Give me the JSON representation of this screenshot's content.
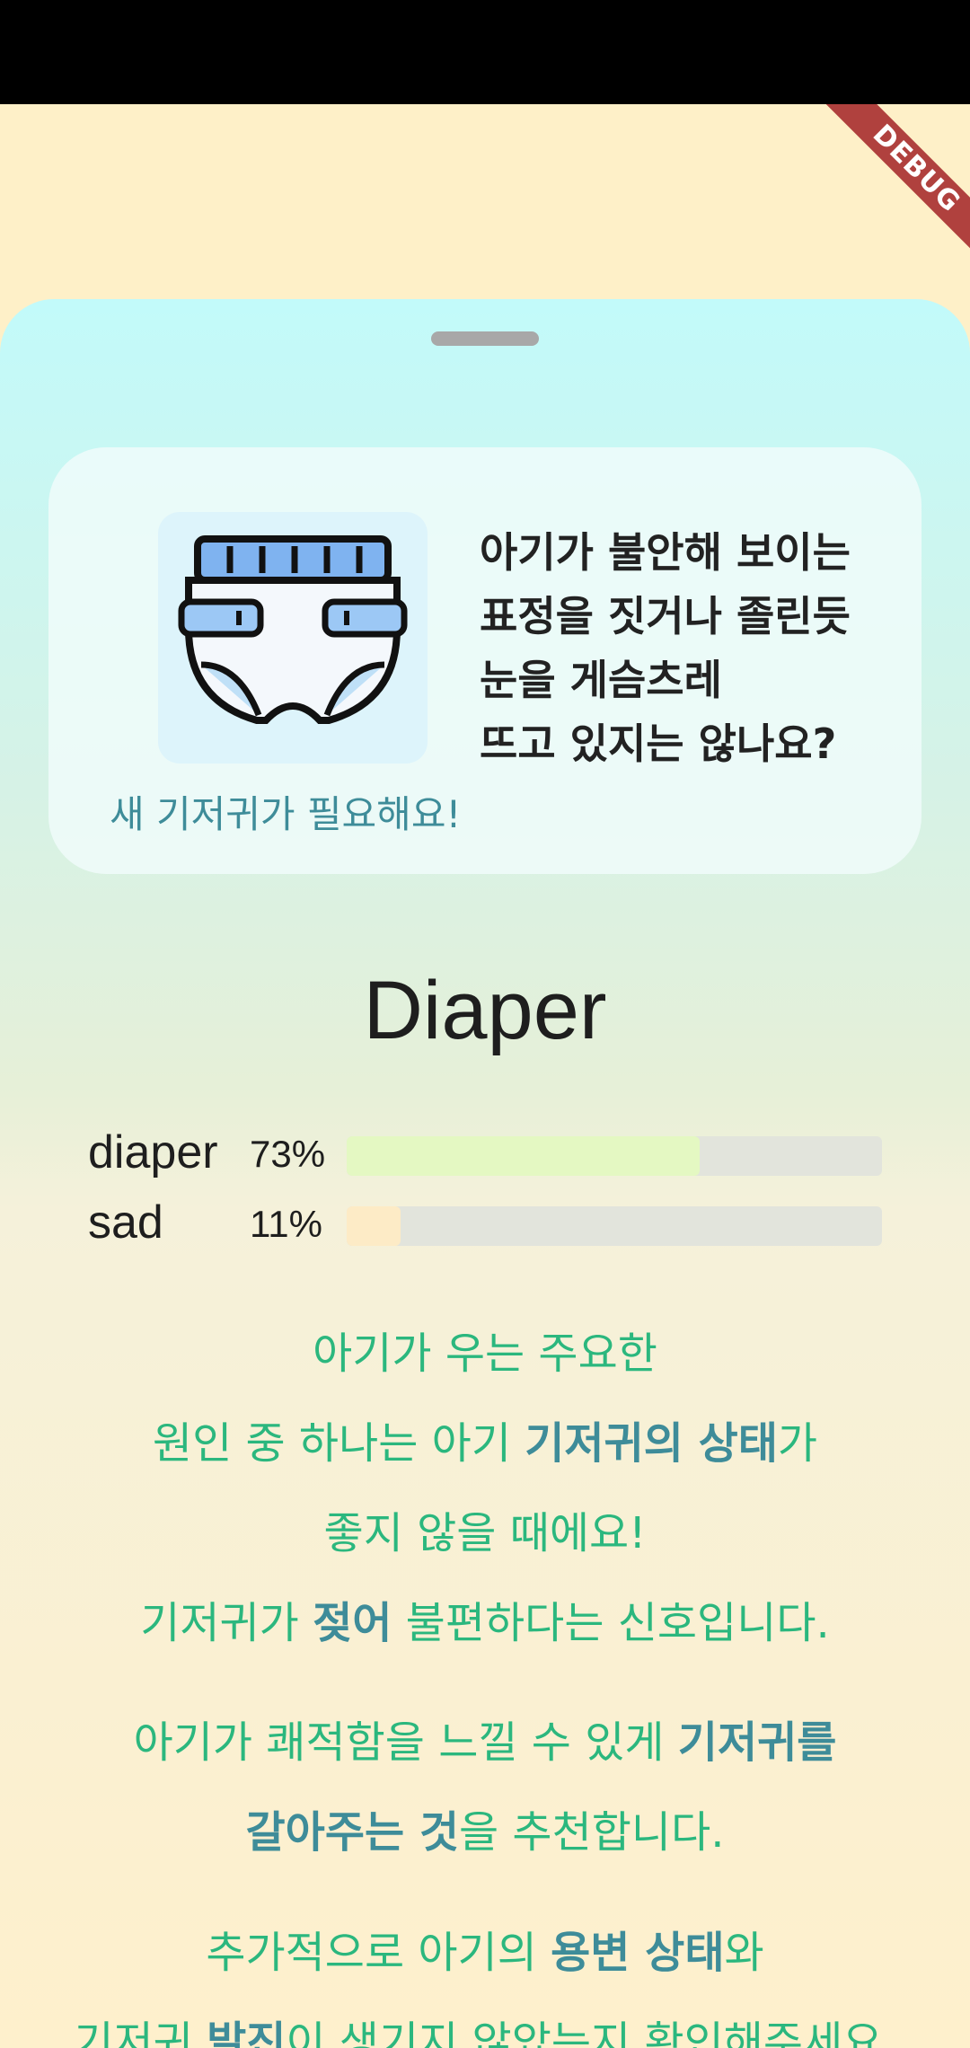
{
  "debug_banner": "DEBUG",
  "card": {
    "question_lines": [
      "아기가 불안해 보이는",
      "표정을 짓거나 졸린듯",
      "눈을 게슴츠레",
      "뜨고 있지는 않나요?"
    ],
    "subtitle": "새 기저귀가 필요해요!",
    "icon": "diaper-icon"
  },
  "class_title": "Diaper",
  "probabilities": [
    {
      "label": "diaper",
      "percent_text": "73%",
      "value": 0.66,
      "color": "#E4F8C2"
    },
    {
      "label": "sad",
      "percent_text": "11%",
      "value": 0.1,
      "color": "#FDEBC6"
    }
  ],
  "advice": {
    "p1": {
      "l1": "아기가 우는 주요한",
      "l2a": "원인 중 하나는 아기 ",
      "l2b": "기저귀의 상태",
      "l2c": "가",
      "l3": "좋지 않을 때에요!",
      "l4a": "기저귀가 ",
      "l4b": "젖어",
      "l4c": " 불편하다는 신호입니다."
    },
    "p2": {
      "l1a": "아기가 쾌적함을 느낄 수 있게 ",
      "l1b": "기저귀를",
      "l2a": "갈아주는 것",
      "l2b": "을 추천합니다."
    },
    "p3": {
      "l1a": "추가적으로 아기의 ",
      "l1b": "용변 상태",
      "l1c": "와",
      "l2a": "기저귀 ",
      "l2b": "발진",
      "l2c": "이 생기지 않았는지 확인해주세요."
    }
  },
  "colors": {
    "accent_teal": "#3E8C99",
    "accent_green": "#2BB77E",
    "status_bar": "#000000"
  }
}
